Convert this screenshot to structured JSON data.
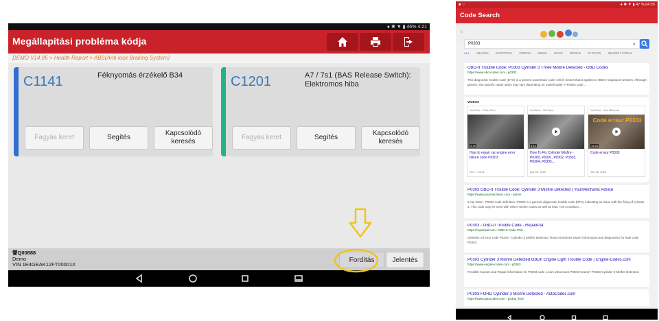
{
  "tablet": {
    "status": {
      "left_icons": "    ",
      "right": "● ✱ ▼ ▮ 46%  4:21"
    },
    "title": "Megállapítási probléma kódja",
    "breadcrumb": "DEMO V14.95 > Health Report > ABS(Anti-lock Braking System)",
    "cards": [
      {
        "code": "C1141",
        "description": "Féknyomás érzékelő B34",
        "accent": "#2e6fd0",
        "buttons": [
          "Fagyás keret",
          "Segítés",
          "Kapcsolódó keresés"
        ]
      },
      {
        "code": "C1201",
        "description": "A7 / 7s1 (BAS Release Switch): Elektromos hiba",
        "accent": "#26b08c",
        "buttons": [
          "Fagyás keret",
          "Segítés",
          "Kapcsolódó keresés"
        ]
      }
    ],
    "footer": {
      "line1": "謍Q00888",
      "line2": "Demo",
      "line3": "VIN 1E4GEAK12FT00001X",
      "translate_label": "Fordítás",
      "report_label": "Jelentés"
    },
    "highlight_color": "#f0c419"
  },
  "phone": {
    "status": {
      "left": "■ ♡",
      "right": "● ✱ ▼ ▮ 47 %  04:25"
    },
    "title": "Code Search",
    "search_value": "P0303",
    "search_clear": "×",
    "tabs": [
      "ALL",
      "IMAGES",
      "SHOPPING",
      "VIDEOS",
      "NEWS",
      "MAPS",
      "BOOKS",
      "FLIGHTS",
      "SEARCH TOOLS"
    ],
    "results_top": {
      "title": "OBD-II Trouble Code: P0303 Cylinder 3 Three Misfire Detected - OBD Codes",
      "url": "https://www.obd-codes.com › p0303",
      "snippet": "This diagnostic trouble code (DTC) is a generic powertrain code, which means that it applies to OBD-II equipped vehicles. Although generic, the specific repair steps may vary depending on make/model. A P0303 code ..."
    },
    "videos_label": "VIDEOS",
    "videos": [
      {
        "source": "YouTube · Peter Finn",
        "duration": "3:19",
        "title": "How to repair car engine error failure code P0303",
        "date": "Dec 7, 2015"
      },
      {
        "source": "YouTube · DIY time",
        "duration": "5:14",
        "title": "How To Fix Cylinder Misfire - P0300, P0301, P0302, P0303, P0304, P0305,...",
        "date": "Apr 28, 2015"
      },
      {
        "source": "YouTube · Joe Mikrocel",
        "duration": "13:44",
        "title": "Code erreur P0303",
        "date": "Jun 26, 2016",
        "overlay": "Code erreur P0303"
      }
    ],
    "results": [
      {
        "title": "P0303 OBD-II Trouble Code: Cylinder 3 Misfire Detected | YourMechanic Advice",
        "url": "https://www.yourmechanic.com › article",
        "snippet": "8 Apr 2016 · P0303 code definition. P0303 is a generic diagnostic trouble code (DTC) indicating an issue with the firing of cylinder 3. This code may be seen with either misfire codes as well as lean / rich condition ..."
      },
      {
        "title": "P0303 - OBD-II Trouble Code - RepairPal",
        "url": "https://repairpal.com › OBD-II-Code-P03...",
        "snippet": "Definition of error code P0303 - Cylinder 3 Misfire Detected. Read emissions expert information and diagnostics for fault code P0303."
      },
      {
        "title": "P0303 Cylinder 3 Misfire Detected OBDII Engine Light Trouble Code | Engine-Codes.com",
        "url": "https://www.engine-codes.com › p0303",
        "snippet": "Possible Causes and Repair Information for P0303 code. Learn what does P0303 means? P0303 Cylinder 3 Misfire Detected."
      },
      {
        "title": "P0303 FORD Cylinder 3 Misfire Detected - AutoCodes.com",
        "url": "https://www.autocodes.com › p0303_ford",
        "snippet": ""
      }
    ]
  }
}
